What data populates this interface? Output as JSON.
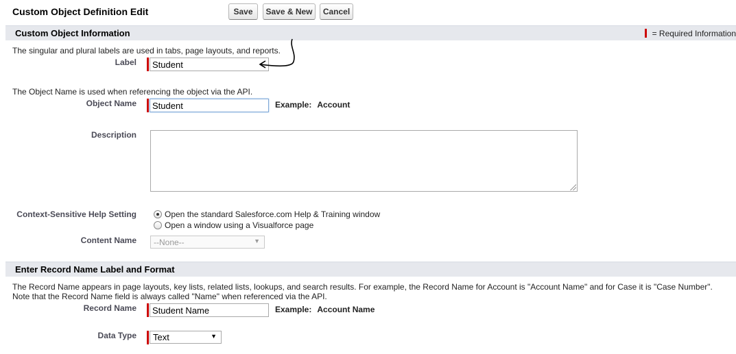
{
  "header": {
    "title": "Custom Object Definition Edit",
    "save_label": "Save",
    "save_new_label": "Save & New",
    "cancel_label": "Cancel"
  },
  "section1": {
    "title": "Custom Object Information",
    "required_legend": "= Required Information",
    "labels_help": "The singular and plural labels are used in tabs, page layouts, and reports.",
    "label_label": "Label",
    "label_value": "Student",
    "object_name_help": "The Object Name is used when referencing the object via the API.",
    "object_name_label": "Object Name",
    "object_name_value": "Student",
    "object_name_example_label": "Example:",
    "object_name_example_value": "Account",
    "description_label": "Description",
    "description_value": "",
    "help_setting_label": "Context-Sensitive Help Setting",
    "help_option_1": "Open the standard Salesforce.com Help & Training window",
    "help_option_2": "Open a window using a Visualforce page",
    "help_selected": 1,
    "content_name_label": "Content Name",
    "content_name_value": "--None--"
  },
  "section2": {
    "title": "Enter Record Name Label and Format",
    "help_line_1": "The Record Name appears in page layouts, key lists, related lists, lookups, and search results. For example, the Record Name for Account is \"Account Name\" and for Case it is \"Case Number\".",
    "help_line_2": "Note that the Record Name field is always called \"Name\" when referenced via the API.",
    "record_name_label": "Record Name",
    "record_name_value": "Student Name",
    "record_name_example_label": "Example:",
    "record_name_example_value": "Account Name",
    "data_type_label": "Data Type",
    "data_type_value": "Text"
  },
  "colors": {
    "required": "#cc0000",
    "section_header_bg": "#e6e8ed",
    "focus_border": "#7ea6d6"
  }
}
